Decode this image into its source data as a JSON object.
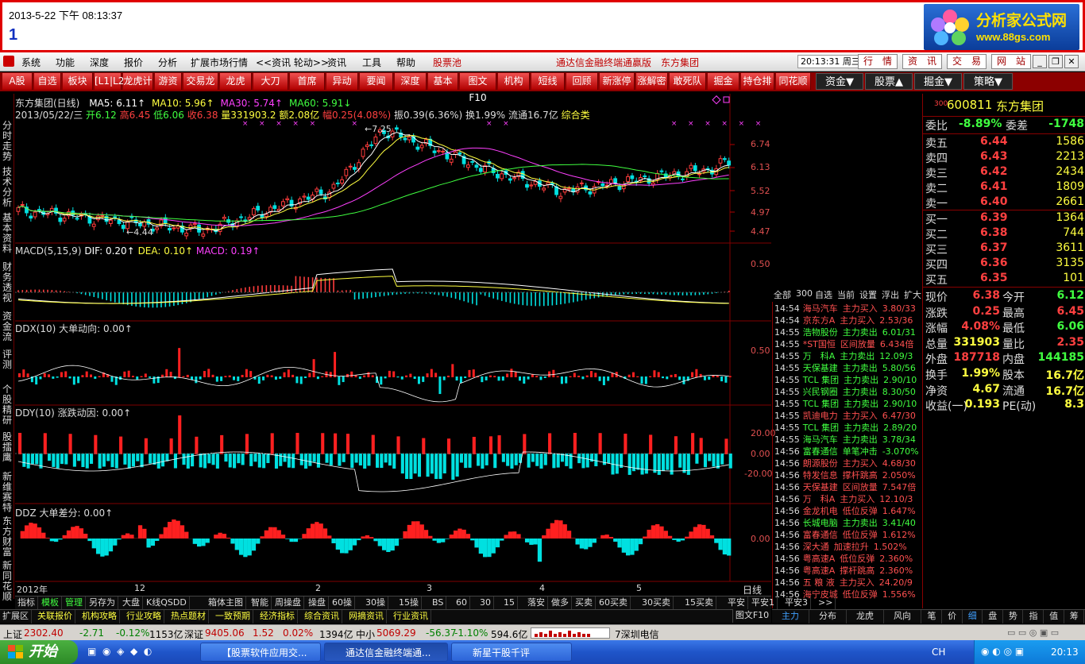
{
  "banner": {
    "datetime": "2013-5-22 下午 08:13:37",
    "number": "1",
    "logo_text": "分析家公式网",
    "logo_url": "www.88gs.com"
  },
  "menu": {
    "items": [
      "系统",
      "功能",
      "深度",
      "报价",
      "分析",
      "扩展市场行情",
      "<<资讯  轮动>>",
      "资讯",
      "工具",
      "帮助"
    ],
    "pool": "股票池",
    "product": "通达信金融终端通赢版",
    "company": "东方集团",
    "clock": "20:13:31 周三",
    "buttons": [
      "行　情",
      "资　讯",
      "交　易",
      "网　站"
    ]
  },
  "toolbar": {
    "items": [
      "A股",
      "自选",
      "板块",
      "[L1|L2]",
      "龙虎计",
      "游资",
      "交易龙",
      "龙虎",
      "大刀",
      "首席",
      "异动",
      "要闻",
      "深度",
      "基本",
      "图文F10",
      "机构",
      "短线",
      "回顾",
      "新涨停",
      "涨解密",
      "敢死队",
      "掘金",
      "持仓排",
      "同花顺"
    ],
    "dropdowns": [
      "资金▼",
      "股票▲",
      "掘金▼",
      "策略▼"
    ]
  },
  "left_tabs": [
    "分时走势",
    "技术分析",
    "基本资料",
    "财务透视",
    "资金流",
    "评测",
    "个股精研",
    "股擂鹰",
    "新维赛特",
    "东方财富",
    "新同花顺"
  ],
  "panels": {
    "kline": {
      "title": "东方集团(日线)",
      "ma": [
        {
          "t": "MA5: 6.11↑",
          "c": "#ffffff"
        },
        {
          "t": "MA10: 5.96↑",
          "c": "#ffff40"
        },
        {
          "t": "MA30: 5.74↑",
          "c": "#ff40ff"
        },
        {
          "t": "MA60: 5.91↓",
          "c": "#40ff40"
        }
      ],
      "line2": "2013/05/22/三",
      "open": "开6.12",
      "high": "高6.45",
      "low": "低6.06",
      "close": "收6.38",
      "vol": "量331903.2",
      "amt": "额2.08亿",
      "range": "幅0.25(4.08%)",
      "amp": "振0.39(6.36%)",
      "turn": "换1.99%",
      "float": "流通16.7亿",
      "sector": "综合类",
      "hi_label": "7.25",
      "lo_label": "4.44",
      "yticks": [
        "6.74",
        "6.13",
        "5.52",
        "4.97",
        "4.47"
      ]
    },
    "macd": {
      "title": "MACD(5,15,9)",
      "dif": "DIF: 0.20↑",
      "dea": "DEA: 0.10↑",
      "macd": "MACD: 0.19↑",
      "yticks": [
        "0.50"
      ]
    },
    "ddx": {
      "title": "DDX(10) 大单动向: 0.00↑",
      "yticks": [
        "0.50"
      ]
    },
    "ddy": {
      "title": "DDY(10) 涨跌动因: 0.00↑",
      "yticks": [
        "20.00",
        "0.00",
        "-20.00"
      ]
    },
    "ddz": {
      "title": "DDZ 大单差分: 0.00↑",
      "yticks": [
        "0.00"
      ]
    }
  },
  "xaxis": [
    "2012年",
    "12",
    "2",
    "3",
    "4",
    "5"
  ],
  "period": "日线",
  "quote": {
    "code": "600811",
    "market": "300",
    "name": "东方集团",
    "webi": {
      "k1": "委比",
      "v1": "-8.89%",
      "k2": "委差",
      "v2": "-1748"
    },
    "sell": [
      {
        "k": "卖五",
        "p": "6.44",
        "v": "1586"
      },
      {
        "k": "卖四",
        "p": "6.43",
        "v": "2213"
      },
      {
        "k": "卖三",
        "p": "6.42",
        "v": "2434"
      },
      {
        "k": "卖二",
        "p": "6.41",
        "v": "1809"
      },
      {
        "k": "卖一",
        "p": "6.40",
        "v": "2661"
      }
    ],
    "buy": [
      {
        "k": "买一",
        "p": "6.39",
        "v": "1364"
      },
      {
        "k": "买二",
        "p": "6.38",
        "v": "744"
      },
      {
        "k": "买三",
        "p": "6.37",
        "v": "3611"
      },
      {
        "k": "买四",
        "p": "6.36",
        "v": "3135"
      },
      {
        "k": "买五",
        "p": "6.35",
        "v": "101"
      }
    ],
    "stats": [
      {
        "k1": "现价",
        "v1": "6.38",
        "c1": "#ff4040",
        "k2": "今开",
        "v2": "6.12",
        "c2": "#40ff40"
      },
      {
        "k1": "涨跌",
        "v1": "0.25",
        "c1": "#ff4040",
        "k2": "最高",
        "v2": "6.45",
        "c2": "#ff4040"
      },
      {
        "k1": "涨幅",
        "v1": "4.08%",
        "c1": "#ff4040",
        "k2": "最低",
        "v2": "6.06",
        "c2": "#40ff40"
      },
      {
        "k1": "总量",
        "v1": "331903",
        "c1": "#ffff40",
        "k2": "量比",
        "v2": "2.35",
        "c2": "#ff4040"
      },
      {
        "k1": "外盘",
        "v1": "187718",
        "c1": "#ff4040",
        "k2": "内盘",
        "v2": "144185",
        "c2": "#40ff40"
      },
      {
        "k1": "换手",
        "v1": "1.99%",
        "c1": "#ffff40",
        "k2": "股本",
        "v2": "16.7亿",
        "c2": "#ffff40"
      },
      {
        "k1": "净资",
        "v1": "4.67",
        "c1": "#ffff40",
        "k2": "流通",
        "v2": "16.7亿",
        "c2": "#ffff40"
      },
      {
        "k1": "收益(一)",
        "v1": "0.193",
        "c1": "#ffff40",
        "k2": "PE(动)",
        "v2": "8.3",
        "c2": "#ffff40"
      }
    ]
  },
  "monitor_tabs": [
    "全部",
    "300",
    "自选",
    "当前",
    "设置",
    "浮出",
    "扩大"
  ],
  "ticks": [
    {
      "t": "14:54",
      "n": "海马汽车",
      "e": "主力买入",
      "v": "3.80/33"
    },
    {
      "t": "14:54",
      "n": "京东方A",
      "e": "主力买入",
      "v": "2.53/36"
    },
    {
      "t": "14:55",
      "n": "浩物股份",
      "e": "主力卖出",
      "v": "6.01/31"
    },
    {
      "t": "14:55",
      "n": "*ST国恒",
      "e": "区间放量",
      "v": "6.434倍"
    },
    {
      "t": "14:55",
      "n": "万　科A",
      "e": "主力卖出",
      "v": "12.09/3"
    },
    {
      "t": "14:55",
      "n": "天保基建",
      "e": "主力卖出",
      "v": "5.80/56"
    },
    {
      "t": "14:55",
      "n": "TCL 集团",
      "e": "主力卖出",
      "v": "2.90/10"
    },
    {
      "t": "14:55",
      "n": "兴民钢圈",
      "e": "主力卖出",
      "v": "8.30/50"
    },
    {
      "t": "14:55",
      "n": "TCL 集团",
      "e": "主力卖出",
      "v": "2.90/10"
    },
    {
      "t": "14:55",
      "n": "凯迪电力",
      "e": "主力买入",
      "v": "6.47/30"
    },
    {
      "t": "14:55",
      "n": "TCL 集团",
      "e": "主力卖出",
      "v": "2.89/20"
    },
    {
      "t": "14:55",
      "n": "海马汽车",
      "e": "主力卖出",
      "v": "3.78/34"
    },
    {
      "t": "14:56",
      "n": "富春通信",
      "e": "单笔冲击",
      "v": "-3.070%"
    },
    {
      "t": "14:56",
      "n": "朗源股份",
      "e": "主力买入",
      "v": "4.68/30"
    },
    {
      "t": "14:56",
      "n": "特发信息",
      "e": "撑杆跳高",
      "v": "2.050%"
    },
    {
      "t": "14:56",
      "n": "天保基建",
      "e": "区间放量",
      "v": "7.547倍"
    },
    {
      "t": "14:56",
      "n": "万　科A",
      "e": "主力买入",
      "v": "12.10/3"
    },
    {
      "t": "14:56",
      "n": "金龙机电",
      "e": "低位反弹",
      "v": "1.647%"
    },
    {
      "t": "14:56",
      "n": "长城电脑",
      "e": "主力卖出",
      "v": "3.41/40"
    },
    {
      "t": "14:56",
      "n": "富春通信",
      "e": "低位反弹",
      "v": "1.612%"
    },
    {
      "t": "14:56",
      "n": "深大通",
      "e": "加速拉升",
      "v": "1.502%"
    },
    {
      "t": "14:56",
      "n": "粤高速A",
      "e": "低位反弹",
      "v": "2.360%"
    },
    {
      "t": "14:56",
      "n": "粤高速A",
      "e": "撑杆跳高",
      "v": "2.360%"
    },
    {
      "t": "14:56",
      "n": "五 粮 液",
      "e": "主力买入",
      "v": "24.20/9"
    },
    {
      "t": "14:56",
      "n": "海宁皮城",
      "e": "低位反弹",
      "v": "1.556%"
    }
  ],
  "bottom1": [
    "指标",
    "模板",
    "管理",
    "另存为",
    "大盘",
    "K线QSDD",
    "箱体主图",
    "智能",
    "周操盘",
    "操盘",
    "60操",
    "30操",
    "15操",
    "BS",
    "60",
    "30",
    "15",
    "落安",
    "做多",
    "买卖",
    "60买卖",
    "30买卖",
    "15买卖",
    "平安",
    "平安1",
    "平安3",
    ">>"
  ],
  "bottom2": [
    "扩展区",
    "关联报价",
    "机构攻略",
    "行业攻略",
    "热点题材",
    "一致预期",
    "经济指标",
    "综合资讯",
    "网摘资讯",
    "行业资讯"
  ],
  "bottom2_right": "图文F10",
  "side_tabs": [
    "主力",
    "分布",
    "龙虎",
    "风向"
  ],
  "quote_tabs": [
    "笔",
    "价",
    "细",
    "盘",
    "势",
    "指",
    "值",
    "筹"
  ],
  "status": {
    "sh_label": "上证",
    "sh": "2302.40",
    "sh_chg": "-2.71",
    "sh_pct": "-0.12%",
    "sh_amt": "1153亿",
    "sz_label": "深证",
    "sz": "9405.06",
    "sz_chg": "1.52",
    "sz_pct": "0.02%",
    "sz_amt": "1394亿",
    "zx_label": "中小",
    "zx": "5069.29",
    "zx_chg": "-56.37",
    "zx_pct": "-1.10%",
    "zx_amt": "594.6亿",
    "broker": "7深圳电信"
  },
  "taskbar": {
    "start": "开始",
    "tasks": [
      "【股票软件应用交...",
      "通达信金融终端通...",
      "新星干股千评"
    ],
    "lang": "CH",
    "time": "20:13"
  }
}
